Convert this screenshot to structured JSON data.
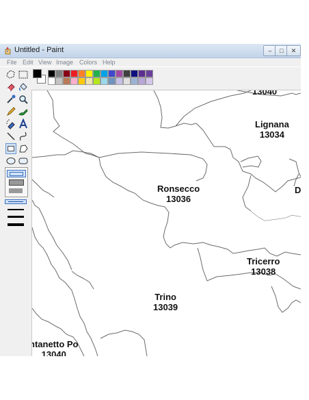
{
  "window": {
    "title": "Untitled - Paint"
  },
  "menu": [
    "File",
    "Edit",
    "View",
    "Image",
    "Colors",
    "Help"
  ],
  "tools": [
    {
      "name": "free-form-select-icon"
    },
    {
      "name": "select-icon"
    },
    {
      "name": "eraser-icon"
    },
    {
      "name": "fill-bucket-icon"
    },
    {
      "name": "color-picker-icon"
    },
    {
      "name": "magnifier-icon"
    },
    {
      "name": "pencil-icon"
    },
    {
      "name": "brush-icon"
    },
    {
      "name": "airbrush-icon"
    },
    {
      "name": "text-icon"
    },
    {
      "name": "line-icon"
    },
    {
      "name": "curve-icon"
    },
    {
      "name": "rectangle-icon"
    },
    {
      "name": "polygon-icon"
    },
    {
      "name": "ellipse-icon"
    },
    {
      "name": "rounded-rectangle-icon"
    }
  ],
  "palette": {
    "foreground": "#000000",
    "background": "#ffffff",
    "row1": [
      "#000000",
      "#7f7f7f",
      "#880015",
      "#ed1c24",
      "#ff7f27",
      "#fff200",
      "#22b14c",
      "#00a2e8",
      "#3f48cc",
      "#a349a4",
      "#404040",
      "#0f0f80",
      "#5c2d91",
      "#6a3f9c"
    ],
    "row2": [
      "#ffffff",
      "#c3c3c3",
      "#b97a57",
      "#ffaec9",
      "#ffc90e",
      "#efe4b0",
      "#b5e61d",
      "#99d9ea",
      "#7092be",
      "#c8bfe7",
      "#e0e0e0",
      "#9db3d6",
      "#b7a6d6",
      "#d4c7ea"
    ]
  },
  "map": {
    "regions": [
      {
        "name": "13040",
        "code": ""
      },
      {
        "name": "Lignana",
        "code": "13034"
      },
      {
        "name": "Ronsecco",
        "code": "13036"
      },
      {
        "name": "D",
        "code": ""
      },
      {
        "name": "Tricerro",
        "code": "13038"
      },
      {
        "name": "Trino",
        "code": "13039"
      },
      {
        "name": "ntanetto Po",
        "code": "13040"
      }
    ]
  }
}
